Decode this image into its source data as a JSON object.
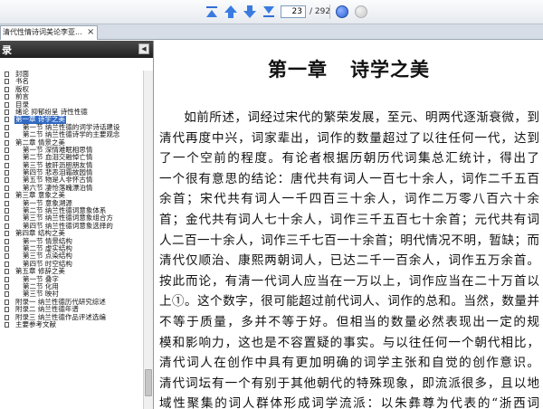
{
  "toolbar": {
    "current_page": "23",
    "total_pages": "/ 292"
  },
  "tab": {
    "title": "清代性情诗词美论",
    "title_suffix": "李亚...",
    "close_glyph": "×"
  },
  "sidebar": {
    "title": "录",
    "collapse_glyph": "◀",
    "items": [
      {
        "level": 1,
        "label": "封面"
      },
      {
        "level": 1,
        "label": "书名"
      },
      {
        "level": 1,
        "label": "版权"
      },
      {
        "level": 1,
        "label": "前言"
      },
      {
        "level": 1,
        "label": "目录"
      },
      {
        "level": 1,
        "label": "绪论 抑郁纷呈 诗性性德"
      },
      {
        "level": 1,
        "label": "第一章 诗学之美",
        "selected": true
      },
      {
        "level": 2,
        "label": "第一节 纳兰性德的词学诗话建设"
      },
      {
        "level": 2,
        "label": "第二节 纳兰性德诗学的主要观念"
      },
      {
        "level": 1,
        "label": "第二章 情景之美"
      },
      {
        "level": 2,
        "label": "第一节 深情难眠相思情"
      },
      {
        "level": 2,
        "label": "第二节 血泪交融悼亡情"
      },
      {
        "level": 2,
        "label": "第三节 披肝沥胆朋友情"
      },
      {
        "level": 2,
        "label": "第四节 悲恶泪霜故园情"
      },
      {
        "level": 2,
        "label": "第五节 物是人非怀古情"
      },
      {
        "level": 2,
        "label": "第六节 凄怆落魄漂泊情"
      },
      {
        "level": 1,
        "label": "第三章 意象之美"
      },
      {
        "level": 2,
        "label": "第一节 意象溯源"
      },
      {
        "level": 2,
        "label": "第二节 纳兰性德词意象体系"
      },
      {
        "level": 2,
        "label": "第三节 纳兰性德词意象组合方"
      },
      {
        "level": 2,
        "label": "第四节 纳兰性德词意象选择的"
      },
      {
        "level": 1,
        "label": "第四章 结构之美"
      },
      {
        "level": 2,
        "label": "第一节 情景结构"
      },
      {
        "level": 2,
        "label": "第二节 虚实结构"
      },
      {
        "level": 2,
        "label": "第三节 点染结构"
      },
      {
        "level": 2,
        "label": "第四节 时空结构"
      },
      {
        "level": 1,
        "label": "第五章 修辞之美"
      },
      {
        "level": 2,
        "label": "第一节 叠字"
      },
      {
        "level": 2,
        "label": "第二节 化用"
      },
      {
        "level": 2,
        "label": "第三节 映衬"
      },
      {
        "level": 1,
        "label": "附录一 纳兰性德历代研究综述"
      },
      {
        "level": 1,
        "label": "附录二 纳兰性德年谱"
      },
      {
        "level": 1,
        "label": "附录三 纳兰性德作品评述选编"
      },
      {
        "level": 1,
        "label": "主要参考文献"
      }
    ]
  },
  "document": {
    "heading": "第一章   诗学之美",
    "lines": [
      "如前所述，词经过宋代的繁荣发展，至元、明两代逐渐衰微，到",
      "清代再度中兴，词家辈出，词作的数量超过了以往任何一代，达到",
      "了一个空前的程度。有论者根据历朝历代词集总汇统计，得出了",
      "一个很有意思的结论：唐代共有词人一百七十余人，词作二千五百",
      "余首；宋代共有词人一千四百三十余人，词作二万零八百六十余",
      "首；金代共有词人七十余人，词作三千五百七十余首；元代共有词",
      "人二百一十余人，词作三千七百一十余首；明代情况不明，暂缺；而",
      "清代仅顺治、康熙两朝词人，已达二千一百余人，词作五万余首。",
      "按此而论，有清一代词人应当在一万以上，词作应当在二十万首以",
      "上①。这个数字，很可能超过前代词人、词作的总和。当然，数量并",
      "不等于质量，多并不等于好。但相当的数量必然表现出一定的规",
      "模和影响力，这也是不容置疑的事实。与以往任何一个朝代相比，",
      "清代词人在创作中具有更加明确的词学主张和自觉的创作意识。",
      "清代词坛有一个有别于其他朝代的特殊现象，即流派很多，且以地",
      "域性聚集的词人群体形成词学流派：以朱彝尊为代表的“浙西词"
    ]
  }
}
